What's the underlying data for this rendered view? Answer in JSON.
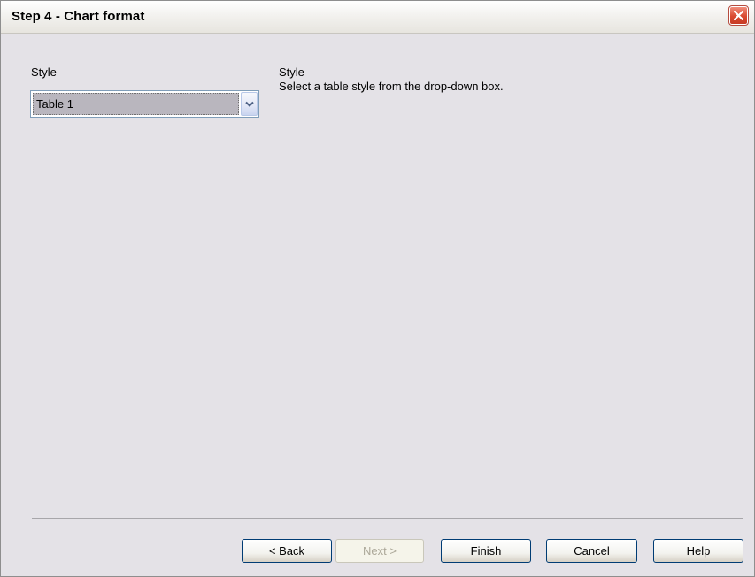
{
  "window": {
    "title": "Step 4 - Chart format",
    "close_icon": "close-x-icon",
    "colors": {
      "content_background": "#e4e2e7",
      "close_button": "#d94a30",
      "selection_highlight": "#b9b6be",
      "disabled_text": "#aca899"
    }
  },
  "style_section": {
    "label": "Style",
    "select": {
      "value": "Table 1",
      "arrow_icon": "chevron-down-icon"
    }
  },
  "help_panel": {
    "title": "Style",
    "text": "Select a table style from the drop-down box."
  },
  "buttons": {
    "back": "< Back",
    "next": "Next >",
    "finish": "Finish",
    "cancel": "Cancel",
    "help": "Help"
  }
}
